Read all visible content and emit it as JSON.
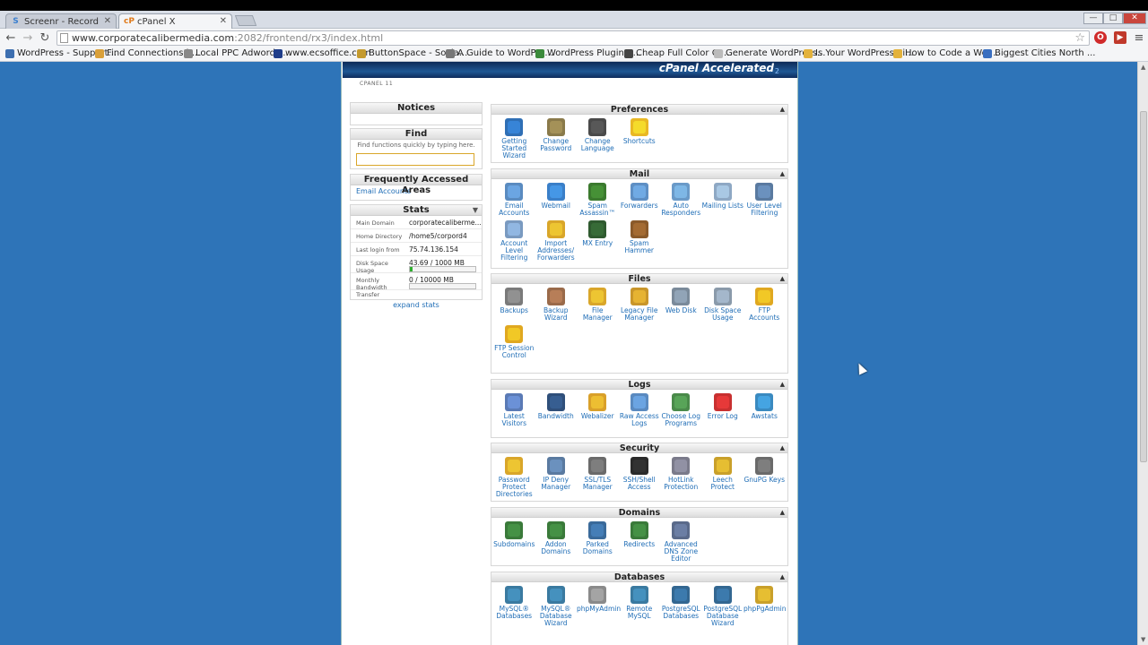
{
  "browser": {
    "tabs": [
      {
        "label": "Screenr - Record",
        "favicon": "S",
        "favicon_color": "#3a7fd0"
      },
      {
        "label": "cPanel X",
        "favicon": "cP",
        "favicon_color": "#e07a1a"
      }
    ],
    "url_host": "www.corporatecalibermedia.com",
    "url_path": ":2082/frontend/rx3/index.html",
    "bookmarks": [
      {
        "label": "WordPress - Support...",
        "color": "#3d6fb0"
      },
      {
        "label": "Find Connections b...",
        "color": "#d9a03a"
      },
      {
        "label": "Local PPC Adwords ...",
        "color": "#888888"
      },
      {
        "label": "www.ecsoffice.com",
        "color": "#1f3d8a"
      },
      {
        "label": "ButtonSpace - Socia...",
        "color": "#c49a2e"
      },
      {
        "label": "A Guide to WordPre...",
        "color": "#777777"
      },
      {
        "label": "WordPress Plugin A...",
        "color": "#3b8a3b"
      },
      {
        "label": "Cheap Full Color Cu...",
        "color": "#444444"
      },
      {
        "label": "Generate WordPress...",
        "color": "#bbbbbb"
      },
      {
        "label": "Is Your WordPress Si...",
        "color": "#e3b23c"
      },
      {
        "label": "How to Code a Wor...",
        "color": "#e3b23c"
      },
      {
        "label": "Biggest Cities North ...",
        "color": "#3a6fc0"
      }
    ]
  },
  "cpanel": {
    "banner_brand": "cPanel Accelerated",
    "banner_sub": "2",
    "breadcrumb": "CPANEL 11",
    "notices": {
      "title": "Notices"
    },
    "find": {
      "title": "Find",
      "hint": "Find functions quickly by typing here.",
      "value": ""
    },
    "frequent": {
      "title": "Frequently Accessed Areas",
      "link": "Email Accounts"
    },
    "stats": {
      "title": "Stats",
      "collapse": "▼",
      "rows": [
        {
          "key": "Main Domain",
          "value": "corporatecaliberme..."
        },
        {
          "key": "Home Directory",
          "value": "/home5/corpord4"
        },
        {
          "key": "Last login from",
          "value": "75.74.136.154"
        },
        {
          "key": "Disk Space Usage",
          "value": "43.69 / 1000 MB",
          "fraction": 0.0437
        },
        {
          "key": "Monthly Bandwidth Transfer",
          "value": "0 / 10000 MB",
          "fraction": 0.0
        }
      ],
      "expand": "expand stats"
    },
    "panels": [
      {
        "title": "Preferences",
        "items": [
          {
            "label": "Getting Started Wizard",
            "icon": "wizard-icon",
            "color": "#2f6fb5"
          },
          {
            "label": "Change Password",
            "icon": "password-icon",
            "color": "#8a7a4a"
          },
          {
            "label": "Change Language",
            "icon": "language-icon",
            "color": "#4a4a4a"
          },
          {
            "label": "Shortcuts",
            "icon": "star-icon",
            "color": "#e9b824"
          }
        ]
      },
      {
        "title": "Mail",
        "items": [
          {
            "label": "Email Accounts",
            "icon": "email-icon",
            "color": "#5a8bc0"
          },
          {
            "label": "Webmail",
            "icon": "webmail-icon",
            "color": "#3a7fc8"
          },
          {
            "label": "Spam Assassin™",
            "icon": "spam-assassin-icon",
            "color": "#3b7a2e"
          },
          {
            "label": "Forwarders",
            "icon": "forwarders-icon",
            "color": "#5e8fc4"
          },
          {
            "label": "Auto Responders",
            "icon": "autoresponder-icon",
            "color": "#6a9ac8"
          },
          {
            "label": "Mailing Lists",
            "icon": "mailing-list-icon",
            "color": "#8ea8c4"
          },
          {
            "label": "User Level Filtering",
            "icon": "filter-icon",
            "color": "#5a7aa0"
          },
          {
            "label": "Account Level Filtering",
            "icon": "account-filter-icon",
            "color": "#7a9ac0"
          },
          {
            "label": "Import Addresses/ Forwarders",
            "icon": "import-icon",
            "color": "#d9a62a"
          },
          {
            "label": "MX Entry",
            "icon": "mx-entry-icon",
            "color": "#2f5a2f"
          },
          {
            "label": "Spam Hammer",
            "icon": "hammer-icon",
            "color": "#8a5a2a"
          }
        ]
      },
      {
        "title": "Files",
        "items": [
          {
            "label": "Backups",
            "icon": "backups-icon",
            "color": "#7a7a7a"
          },
          {
            "label": "Backup Wizard",
            "icon": "backup-wizard-icon",
            "color": "#9a6a4a"
          },
          {
            "label": "File Manager",
            "icon": "folder-icon",
            "color": "#d9a62a"
          },
          {
            "label": "Legacy File Manager",
            "icon": "legacy-folder-icon",
            "color": "#c9962a"
          },
          {
            "label": "Web Disk",
            "icon": "web-disk-icon",
            "color": "#7a8a9a"
          },
          {
            "label": "Disk Space Usage",
            "icon": "disk-usage-icon",
            "color": "#8a9aaa"
          },
          {
            "label": "FTP Accounts",
            "icon": "ftp-icon",
            "color": "#e0a820"
          },
          {
            "label": "FTP Session Control",
            "icon": "ftp-session-icon",
            "color": "#e0a820"
          }
        ]
      },
      {
        "title": "Logs",
        "items": [
          {
            "label": "Latest Visitors",
            "icon": "visitors-icon",
            "color": "#5a7ab5"
          },
          {
            "label": "Bandwidth",
            "icon": "bandwidth-icon",
            "color": "#2f4f7a"
          },
          {
            "label": "Webalizer",
            "icon": "webalizer-icon",
            "color": "#d9a02a"
          },
          {
            "label": "Raw Access Logs",
            "icon": "raw-logs-icon",
            "color": "#5a8ac0"
          },
          {
            "label": "Choose Log Programs",
            "icon": "log-programs-icon",
            "color": "#4a8a4a"
          },
          {
            "label": "Error Log",
            "icon": "error-log-icon",
            "color": "#c83030"
          },
          {
            "label": "Awstats",
            "icon": "awstats-icon",
            "color": "#3a8ac0"
          }
        ]
      },
      {
        "title": "Security",
        "items": [
          {
            "label": "Password Protect Directories",
            "icon": "protect-dir-icon",
            "color": "#d9a62a"
          },
          {
            "label": "IP Deny Manager",
            "icon": "ip-deny-icon",
            "color": "#5a7aa0"
          },
          {
            "label": "SSL/TLS Manager",
            "icon": "ssl-icon",
            "color": "#6a6a6a"
          },
          {
            "label": "SSH/Shell Access",
            "icon": "ssh-icon",
            "color": "#2a2a2a"
          },
          {
            "label": "HotLink Protection",
            "icon": "hotlink-icon",
            "color": "#7a7a8a"
          },
          {
            "label": "Leech Protect",
            "icon": "leech-icon",
            "color": "#c9a02a"
          },
          {
            "label": "GnuPG Keys",
            "icon": "key-icon",
            "color": "#6a6a6a"
          }
        ]
      },
      {
        "title": "Domains",
        "items": [
          {
            "label": "Subdomains",
            "icon": "subdomains-icon",
            "color": "#3a7a3a"
          },
          {
            "label": "Addon Domains",
            "icon": "addon-domains-icon",
            "color": "#3a7a3a"
          },
          {
            "label": "Parked Domains",
            "icon": "parked-domains-icon",
            "color": "#3a6a9a"
          },
          {
            "label": "Redirects",
            "icon": "redirects-icon",
            "color": "#3a7a3a"
          },
          {
            "label": "Advanced DNS Zone Editor",
            "icon": "dns-icon",
            "color": "#5a6a8a"
          }
        ]
      },
      {
        "title": "Databases",
        "items": [
          {
            "label": "MySQL® Databases",
            "icon": "mysql-icon",
            "color": "#3a7aa0"
          },
          {
            "label": "MySQL® Database Wizard",
            "icon": "mysql-wizard-icon",
            "color": "#3a7aa0"
          },
          {
            "label": "phpMyAdmin",
            "icon": "phpmyadmin-icon",
            "color": "#8a8a8a"
          },
          {
            "label": "Remote MySQL",
            "icon": "remote-mysql-icon",
            "color": "#3a7aa0"
          },
          {
            "label": "PostgreSQL Databases",
            "icon": "postgresql-icon",
            "color": "#336791"
          },
          {
            "label": "PostgreSQL Database Wizard",
            "icon": "postgresql-wizard-icon",
            "color": "#336791"
          },
          {
            "label": "phpPgAdmin",
            "icon": "phppgadmin-icon",
            "color": "#c9a02a"
          }
        ]
      }
    ]
  }
}
